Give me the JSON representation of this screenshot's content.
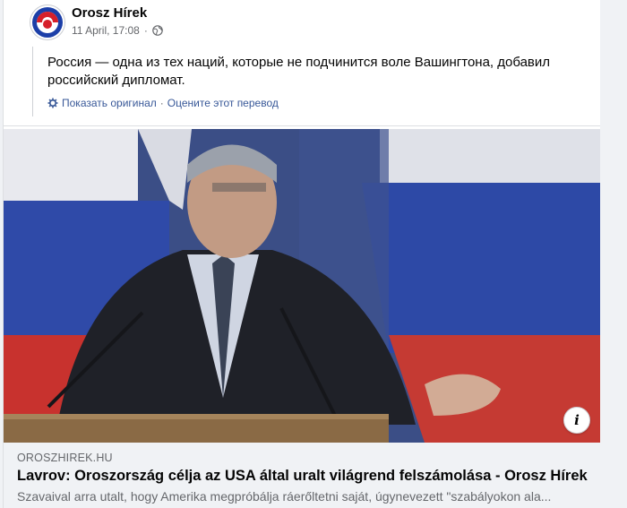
{
  "post": {
    "page_name": "Orosz Hírek",
    "timestamp": "11 April, 17:08",
    "audience_icon": "globe-icon",
    "text": "Россия — одна из тех наций, которые не подчинится воле Вашингтона, добавил российский дипломат.",
    "translation": {
      "icon": "gear-icon",
      "show_original": "Показать оригинал",
      "separator": "·",
      "rate_translation": "Оцените этот перевод"
    }
  },
  "link_preview": {
    "domain": "OROSZHIREK.HU",
    "headline": "Lavrov: Oroszország célja az USA által uralt világrend felszámolása - Orosz Hírek",
    "description": "Szavaival arra utalt, hogy Amerika megpróbálja ráerőltetni saját, úgynevezett \"szabályokon ala...",
    "info_label": "i"
  },
  "colors": {
    "link": "#385898",
    "secondary_text": "#65676b",
    "preview_bg": "#f0f2f5"
  }
}
